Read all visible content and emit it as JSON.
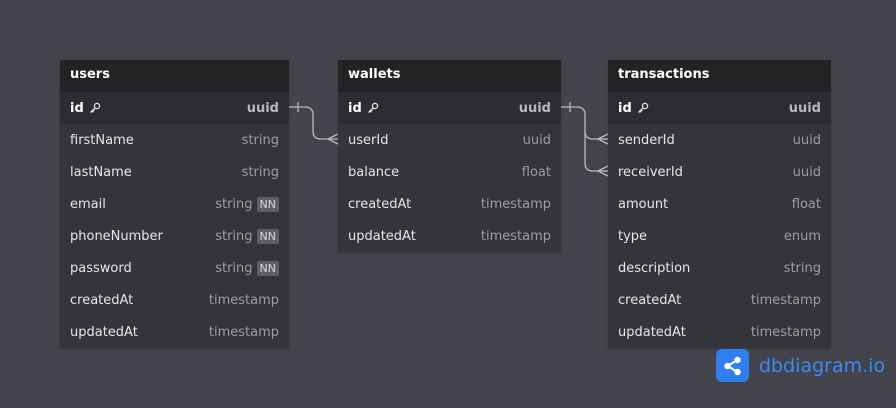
{
  "tables": [
    {
      "name": "users",
      "fields": [
        {
          "name": "id",
          "type": "uuid",
          "pk": true
        },
        {
          "name": "firstName",
          "type": "string"
        },
        {
          "name": "lastName",
          "type": "string"
        },
        {
          "name": "email",
          "type": "string",
          "badge": "NN"
        },
        {
          "name": "phoneNumber",
          "type": "string",
          "badge": "NN"
        },
        {
          "name": "password",
          "type": "string",
          "badge": "NN"
        },
        {
          "name": "createdAt",
          "type": "timestamp"
        },
        {
          "name": "updatedAt",
          "type": "timestamp"
        }
      ]
    },
    {
      "name": "wallets",
      "fields": [
        {
          "name": "id",
          "type": "uuid",
          "pk": true
        },
        {
          "name": "userId",
          "type": "uuid"
        },
        {
          "name": "balance",
          "type": "float"
        },
        {
          "name": "createdAt",
          "type": "timestamp"
        },
        {
          "name": "updatedAt",
          "type": "timestamp"
        }
      ]
    },
    {
      "name": "transactions",
      "fields": [
        {
          "name": "id",
          "type": "uuid",
          "pk": true
        },
        {
          "name": "senderId",
          "type": "uuid"
        },
        {
          "name": "receiverId",
          "type": "uuid"
        },
        {
          "name": "amount",
          "type": "float"
        },
        {
          "name": "type",
          "type": "enum"
        },
        {
          "name": "description",
          "type": "string"
        },
        {
          "name": "createdAt",
          "type": "timestamp"
        },
        {
          "name": "updatedAt",
          "type": "timestamp"
        }
      ]
    }
  ],
  "relationships": [
    {
      "from": "users.id",
      "to": "wallets.userId",
      "cardinality": "one-to-many"
    },
    {
      "from": "wallets.id",
      "to": "transactions.senderId",
      "cardinality": "one-to-many"
    },
    {
      "from": "wallets.id",
      "to": "transactions.receiverId",
      "cardinality": "one-to-many"
    }
  ],
  "brand": {
    "text": "dbdiagram.io",
    "color": "#3a8cf5",
    "logo_color": "#2f7ff0"
  },
  "colors": {
    "background": "#43434b",
    "header": "#232326",
    "table_body": "#34343b",
    "connector": "#b8b8be"
  }
}
